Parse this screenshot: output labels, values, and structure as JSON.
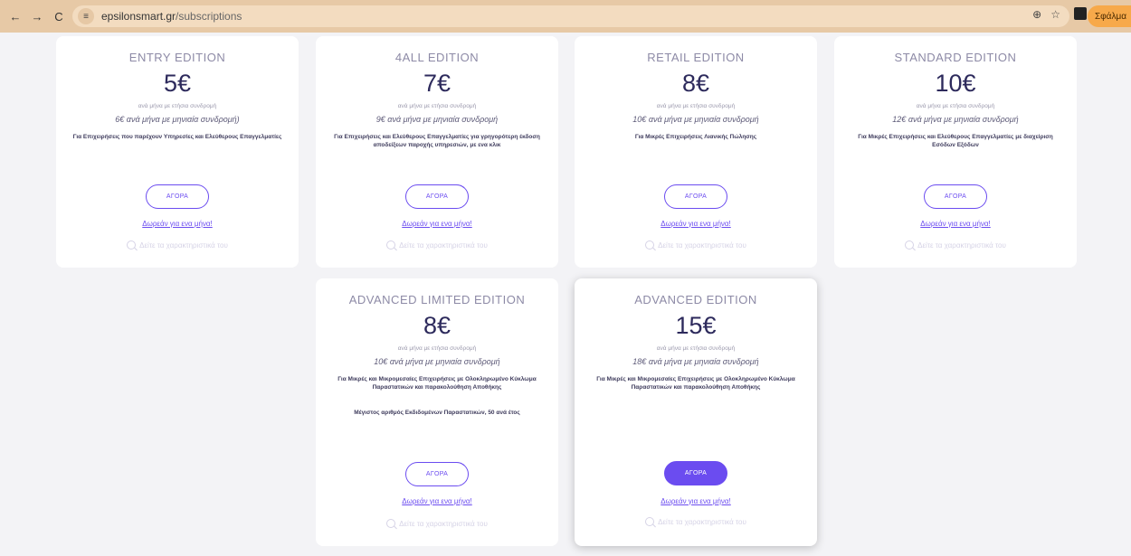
{
  "browser": {
    "url_domain": "epsilonsmart.gr",
    "url_path": "/subscriptions",
    "error_label": "Σφάλμα"
  },
  "colors": {
    "accent": "#6b4cf0",
    "chrome": "#e7c9a6"
  },
  "plans": [
    {
      "edition": "ENTRY EDITION",
      "price": "5€",
      "yearly": "ανά μήνα με ετήσια συνδρομή",
      "monthly": "6€ ανά μήνα με μηνιαία συνδρομή)",
      "description": "Για Επιχειρήσεις που παρέχουν Υπηρεσίες και Ελεύθερους Επαγγελματίες",
      "buy_label": "ΑΓΟΡΑ",
      "free_label": "Δωρεάν για ενα μήνα!",
      "features_label": "Δείτε τα χαρακτηριστικά του"
    },
    {
      "edition": "4ALL EDITION",
      "price": "7€",
      "yearly": "ανά μήνα με ετήσια συνδρομή",
      "monthly": "9€ ανά μήνα με μηνιαία συνδρομή",
      "description": "Για Επιχειρήσεις και Ελεύθερους Επαγγελματίες για γρηγορότερη έκδοση αποδείξεων παροχής υπηρεσιών, με ενα κλικ",
      "buy_label": "ΑΓΟΡΑ",
      "free_label": "Δωρεάν για ενα μήνα!",
      "features_label": "Δείτε τα χαρακτηριστικά του"
    },
    {
      "edition": "RETAIL EDITION",
      "price": "8€",
      "yearly": "ανά μήνα με ετήσια συνδρομή",
      "monthly": "10€ ανά μήνα με μηνιαία συνδρομή",
      "description": "Για Μικρές Επιχειρήσεις Λιανικής Πώλησης",
      "buy_label": "ΑΓΟΡΑ",
      "free_label": "Δωρεάν για ενα μήνα!",
      "features_label": "Δείτε τα χαρακτηριστικά του"
    },
    {
      "edition": "STANDARD EDITION",
      "price": "10€",
      "yearly": "ανά μήνα με ετήσια συνδρομή",
      "monthly": "12€ ανά μήνα με μηνιαία συνδρομή",
      "description": "Για Μικρές Επιχειρήσεις και Ελεύθερους Επαγγελματίες με διαχείριση Εσόδων Εξόδων",
      "buy_label": "ΑΓΟΡΑ",
      "free_label": "Δωρεάν για ενα μήνα!",
      "features_label": "Δείτε τα χαρακτηριστικά του"
    },
    {
      "edition": "ADVANCED LIMITED EDITION",
      "price": "8€",
      "yearly": "ανά μήνα με ετήσια συνδρομή",
      "monthly": "10€ ανά μήνα με μηνιαία συνδρομή",
      "description": "Για Μικρές και Μικρομεσαίες Επιχειρήσεις με Ολοκληρωμένο Κύκλωμα Παραστατικών και παρακολούθηση Αποθήκης",
      "extra": "Μέγιστος αριθμός Εκδιδομένων Παραστατικών, 50 ανά έτος",
      "buy_label": "ΑΓΟΡΑ",
      "free_label": "Δωρεάν για ενα μήνα!",
      "features_label": "Δείτε τα χαρακτηριστικά του"
    },
    {
      "edition": "ADVANCED EDITION",
      "price": "15€",
      "yearly": "ανά μήνα με ετήσια συνδρομή",
      "monthly": "18€ ανά μήνα με μηνιαία συνδρομή",
      "description": "Για Μικρές και Μικρομεσαίες Επιχειρήσεις με Ολοκληρωμένο Κύκλωμα Παραστατικών και παρακολούθηση Αποθήκης",
      "buy_label": "ΑΓΟΡΑ",
      "free_label": "Δωρεάν για ενα μήνα!",
      "features_label": "Δείτε τα χαρακτηριστικά του"
    }
  ]
}
